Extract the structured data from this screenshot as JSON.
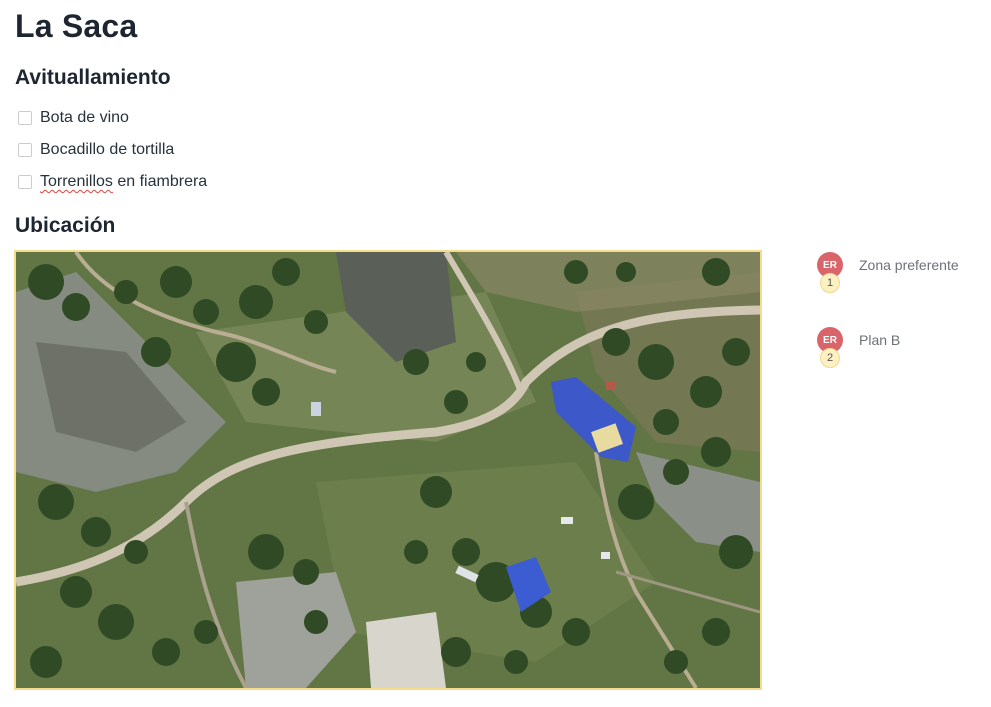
{
  "page": {
    "title": "La Saca"
  },
  "provisions": {
    "heading": "Avituallamiento",
    "items": [
      {
        "label": "Bota de vino",
        "checked": false
      },
      {
        "label": "Bocadillo de tortilla",
        "checked": false
      },
      {
        "label_misspelled": "Torrenillos",
        "label_rest": " en fiambrera",
        "checked": false
      }
    ]
  },
  "location": {
    "heading": "Ubicación",
    "map_image": "satellite-view",
    "pins": [
      {
        "badge": "ER",
        "number": "1",
        "label": "Zona preferente"
      },
      {
        "badge": "ER",
        "number": "2",
        "label": "Plan B"
      }
    ]
  },
  "colors": {
    "pin_badge": "#d9646a",
    "pin_number_bg": "#fdf0c2",
    "map_border": "#f4dc8c"
  }
}
